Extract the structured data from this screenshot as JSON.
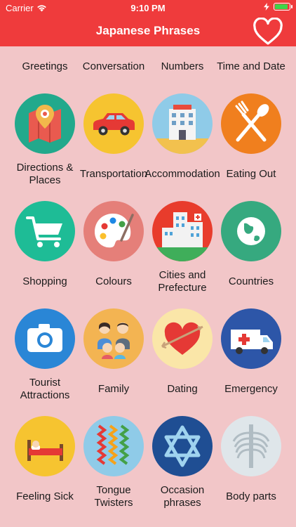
{
  "status": {
    "carrier": "Carrier",
    "time": "9:10 PM",
    "battery_level": 0.95
  },
  "header": {
    "title": "Japanese Phrases"
  },
  "colors": {
    "header_red": "#ef3b3c",
    "background": "#f2c6c8",
    "text": "#1b1b1b"
  },
  "top_row": [
    {
      "label": "Greetings"
    },
    {
      "label": "Conversation"
    },
    {
      "label": "Numbers"
    },
    {
      "label": "Time and Date"
    }
  ],
  "categories": [
    {
      "label": "Directions & Places",
      "icon": "map-pin-icon"
    },
    {
      "label": "Transportation",
      "icon": "car-icon"
    },
    {
      "label": "Accommodation",
      "icon": "hotel-icon"
    },
    {
      "label": "Eating Out",
      "icon": "fork-spoon-icon"
    },
    {
      "label": "Shopping",
      "icon": "shopping-cart-icon"
    },
    {
      "label": "Colours",
      "icon": "palette-icon"
    },
    {
      "label": "Cities and Prefecture",
      "icon": "city-buildings-icon"
    },
    {
      "label": "Countries",
      "icon": "globe-icon"
    },
    {
      "label": "Tourist Attractions",
      "icon": "camera-icon"
    },
    {
      "label": "Family",
      "icon": "family-icon"
    },
    {
      "label": "Dating",
      "icon": "heart-arrow-icon"
    },
    {
      "label": "Emergency",
      "icon": "ambulance-icon"
    },
    {
      "label": "Feeling Sick",
      "icon": "sick-bed-icon"
    },
    {
      "label": "Tongue Twisters",
      "icon": "twisted-strands-icon"
    },
    {
      "label": "Occasion phrases",
      "icon": "star-of-david-icon"
    },
    {
      "label": "Body parts",
      "icon": "skeleton-icon"
    }
  ]
}
